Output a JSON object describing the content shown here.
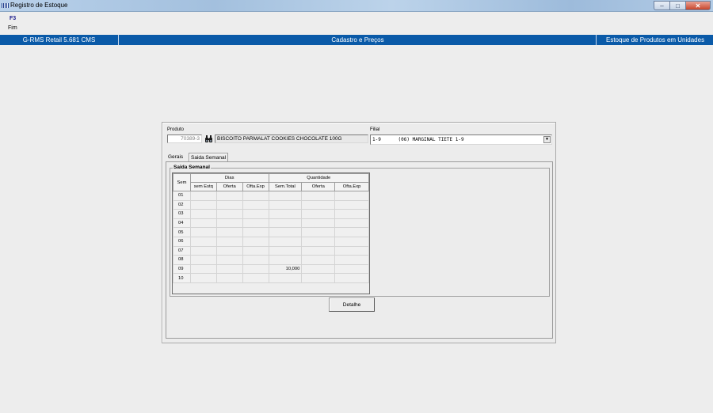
{
  "window": {
    "title": "Registro de Estoque"
  },
  "menu": {
    "key": "F3",
    "label": "Fim"
  },
  "statusbar": {
    "app": "G-RMS Retail 5.681 CMS",
    "section": "Cadastro e Preços",
    "module": "Estoque de Produtos em Unidades"
  },
  "form": {
    "produto_label": "Produto",
    "produto_code": "70389-3",
    "produto_desc": "BISCOITO PARMALAT COOKIES CHOCOLATE 100G",
    "filial_label": "Filial",
    "filial_value": "1-9      (06) MARGINAL TIETE 1-9"
  },
  "tabs": [
    {
      "label": "Gerais"
    },
    {
      "label": "Saida Semanal"
    }
  ],
  "group": {
    "title": "Saida Semanal"
  },
  "grid": {
    "header_sem": "Sem",
    "group_dias": "Dias",
    "group_quantidade": "Quantidade",
    "columns": [
      "sem Estq",
      "Oferta",
      "Ofta.Exp",
      "Sem.Total",
      "Oferta",
      "Ofta.Exp"
    ],
    "rows": [
      {
        "sem": "01",
        "cells": [
          "",
          "",
          "",
          "",
          "",
          ""
        ]
      },
      {
        "sem": "02",
        "cells": [
          "",
          "",
          "",
          "",
          "",
          ""
        ]
      },
      {
        "sem": "03",
        "cells": [
          "",
          "",
          "",
          "",
          "",
          ""
        ]
      },
      {
        "sem": "04",
        "cells": [
          "",
          "",
          "",
          "",
          "",
          ""
        ]
      },
      {
        "sem": "05",
        "cells": [
          "",
          "",
          "",
          "",
          "",
          ""
        ]
      },
      {
        "sem": "06",
        "cells": [
          "",
          "",
          "",
          "",
          "",
          ""
        ]
      },
      {
        "sem": "07",
        "cells": [
          "",
          "",
          "",
          "",
          "",
          ""
        ]
      },
      {
        "sem": "08",
        "cells": [
          "",
          "",
          "",
          "",
          "",
          ""
        ]
      },
      {
        "sem": "09",
        "cells": [
          "",
          "",
          "",
          "10,000",
          "",
          ""
        ]
      },
      {
        "sem": "10",
        "cells": [
          "",
          "",
          "",
          "",
          "",
          ""
        ]
      }
    ]
  },
  "buttons": {
    "detalhe": "Detalhe"
  }
}
